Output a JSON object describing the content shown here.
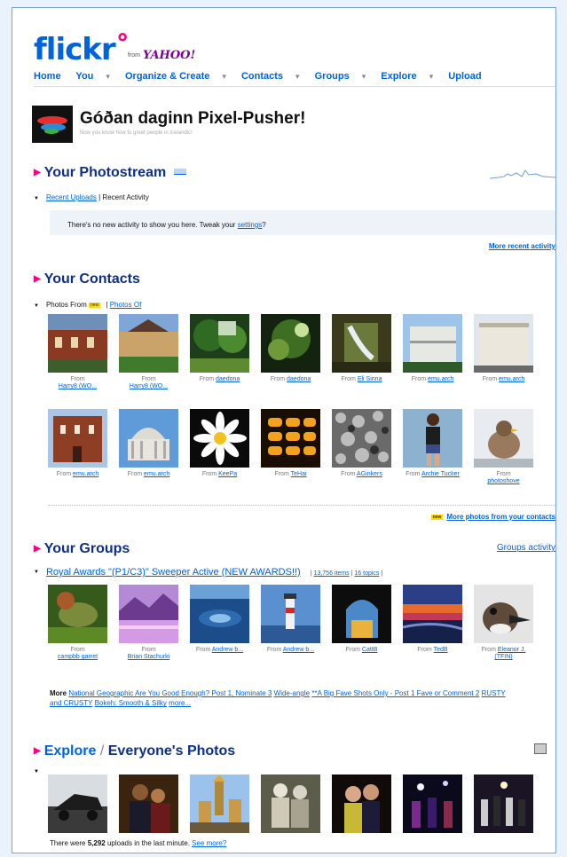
{
  "brand": {
    "logo_main": "flickr",
    "logo_suffix": "",
    "from_label": "from",
    "yahoo": "YAHOO!"
  },
  "nav": [
    "Home",
    "You",
    "Organize & Create",
    "Contacts",
    "Groups",
    "Explore",
    "Upload"
  ],
  "nav_arrow": "▾",
  "greeting": {
    "title": "Góðan daginn Pixel-Pusher!",
    "subtitle": "Now you know how to greet people in Icelandic!"
  },
  "photostream": {
    "title": "Your Photostream",
    "tab_recent_uploads": "Recent Uploads",
    "tab_sep": "|",
    "tab_recent_activity": "Recent Activity",
    "notice_text": "There's no new activity to show you here. Tweak your",
    "notice_link": "settings",
    "notice_end": "?",
    "more_link": "More recent activity"
  },
  "contacts": {
    "title": "Your Contacts",
    "tab_photos_from": "Photos From",
    "new_badge": "new",
    "tab_sep": "|",
    "tab_photos_of": "Photos Of",
    "row1": [
      {
        "from": "From",
        "user": "Harry8 (WO..."
      },
      {
        "from": "From",
        "user": "Harry8 (WO..."
      },
      {
        "from": "From",
        "user": "daedona"
      },
      {
        "from": "From",
        "user": "daedona"
      },
      {
        "from": "From",
        "user": "Eli Sinna"
      },
      {
        "from": "From",
        "user": "emu.arch"
      },
      {
        "from": "From",
        "user": "emu.arch"
      }
    ],
    "row2": [
      {
        "from": "From",
        "user": "emu.arch"
      },
      {
        "from": "From",
        "user": "emu.arch"
      },
      {
        "from": "From",
        "user": "KeePa"
      },
      {
        "from": "From",
        "user": "TeHai"
      },
      {
        "from": "From",
        "user": "AGinkers"
      },
      {
        "from": "From",
        "user": "Archie Tucker"
      },
      {
        "from": "From",
        "user": "photoshove"
      }
    ],
    "more_link": "More photos from your contacts"
  },
  "groups": {
    "title": "Your Groups",
    "activity_link": "Groups activity",
    "group_name": "Royal Awards \"(P1/C3)\" Sweeper Active (NEW AWARDS!!)",
    "items_count": "13,756 items",
    "sep": "|",
    "topics_count": "16 topics",
    "row": [
      {
        "from": "From",
        "user": "campbb garret"
      },
      {
        "from": "From",
        "user": "Brian Stachurki"
      },
      {
        "from": "From",
        "user": "Andrew b..."
      },
      {
        "from": "From",
        "user": "Andrew b..."
      },
      {
        "from": "From",
        "user": "CattB"
      },
      {
        "from": "From",
        "user": "TedB"
      },
      {
        "from": "From",
        "user": "Eleanor J. (TFIN)"
      }
    ],
    "more_label": "More",
    "more_groups": [
      "National Geographic Are You Good Enough? Post 1, Nominate 3",
      "Wide-angle",
      "**A Big Fave Shots Only - Post 1 Fave or Comment 2",
      "RUSTY and CRUSTY",
      "Bokeh: Smooth & Silky",
      "more..."
    ]
  },
  "explore": {
    "title_a": "Explore",
    "slash": "/",
    "title_b": "Everyone's Photos",
    "footer_pre": "There were",
    "footer_count": "5,292",
    "footer_post": "uploads in the last minute.",
    "footer_link": "See more?"
  },
  "colors": {
    "accent": "#0063dc",
    "pink": "#ff0084",
    "heading": "#0e2f88"
  }
}
